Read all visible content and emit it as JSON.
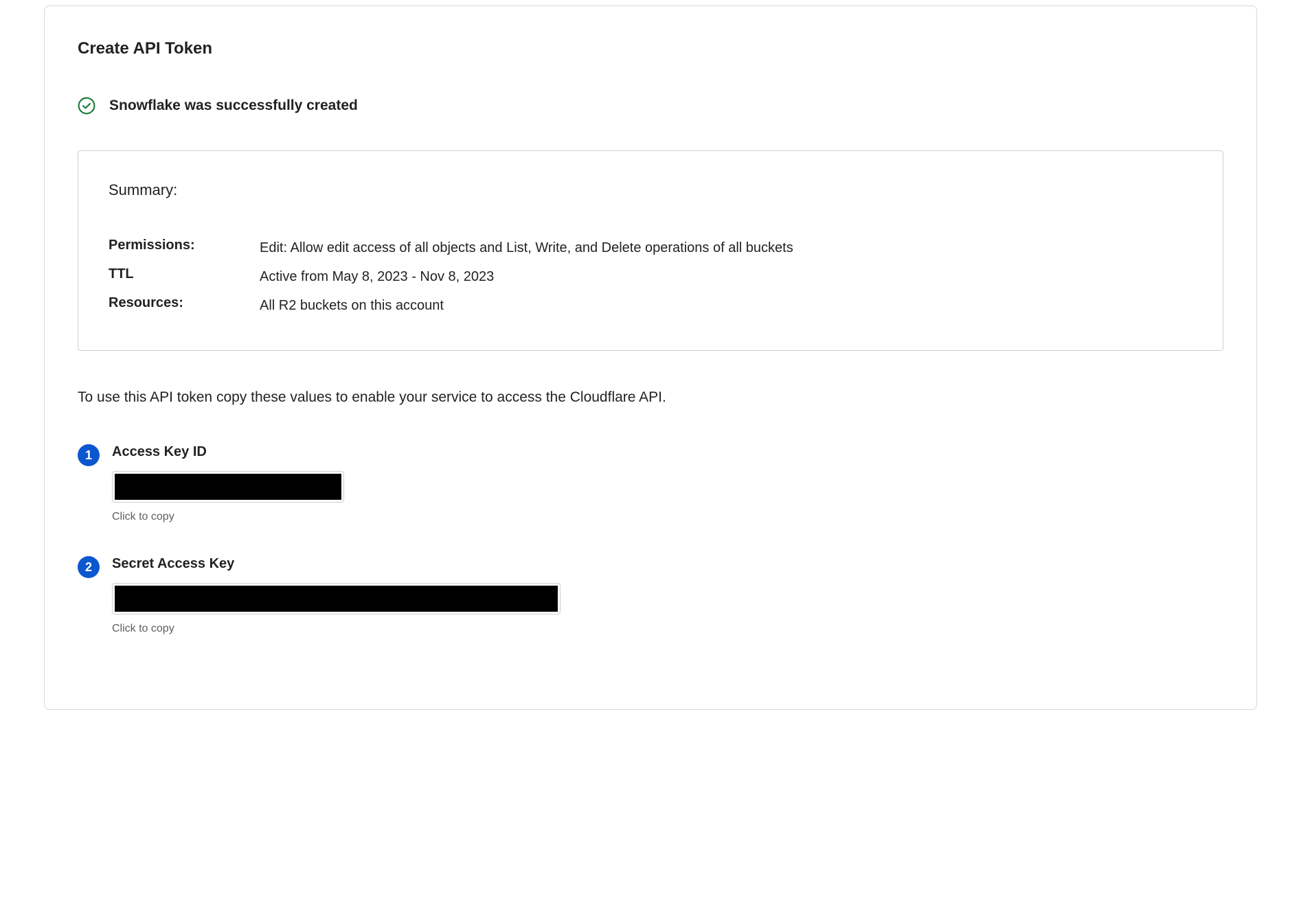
{
  "page_title": "Create API Token",
  "success_message": "Snowflake was successfully created",
  "summary": {
    "heading": "Summary:",
    "rows": [
      {
        "label": "Permissions:",
        "value": "Edit: Allow edit access of all objects and List, Write, and Delete operations of all buckets"
      },
      {
        "label": "TTL",
        "value": "Active from May 8, 2023 - Nov 8, 2023"
      },
      {
        "label": "Resources:",
        "value": "All R2 buckets on this account"
      }
    ]
  },
  "instructions": "To use this API token copy these values to enable your service to access the Cloudflare API.",
  "keys": {
    "access_key": {
      "step": "1",
      "label": "Access Key ID",
      "copy_hint": "Click to copy"
    },
    "secret_key": {
      "step": "2",
      "label": "Secret Access Key",
      "copy_hint": "Click to copy"
    }
  }
}
